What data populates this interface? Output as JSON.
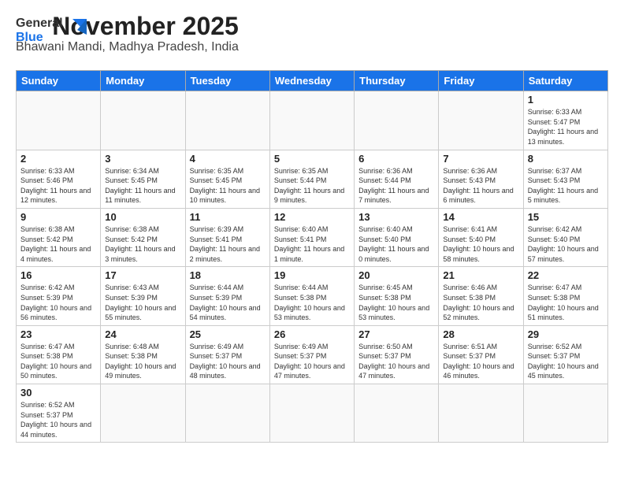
{
  "logo": {
    "general": "General",
    "blue": "Blue"
  },
  "header": {
    "month": "November 2025",
    "location": "Bhawani Mandi, Madhya Pradesh, India"
  },
  "weekdays": [
    "Sunday",
    "Monday",
    "Tuesday",
    "Wednesday",
    "Thursday",
    "Friday",
    "Saturday"
  ],
  "days": {
    "d1": {
      "n": "1",
      "sr": "6:33 AM",
      "ss": "5:47 PM",
      "dl": "11 hours and 13 minutes."
    },
    "d2": {
      "n": "2",
      "sr": "6:33 AM",
      "ss": "5:46 PM",
      "dl": "11 hours and 12 minutes."
    },
    "d3": {
      "n": "3",
      "sr": "6:34 AM",
      "ss": "5:45 PM",
      "dl": "11 hours and 11 minutes."
    },
    "d4": {
      "n": "4",
      "sr": "6:35 AM",
      "ss": "5:45 PM",
      "dl": "11 hours and 10 minutes."
    },
    "d5": {
      "n": "5",
      "sr": "6:35 AM",
      "ss": "5:44 PM",
      "dl": "11 hours and 9 minutes."
    },
    "d6": {
      "n": "6",
      "sr": "6:36 AM",
      "ss": "5:44 PM",
      "dl": "11 hours and 7 minutes."
    },
    "d7": {
      "n": "7",
      "sr": "6:36 AM",
      "ss": "5:43 PM",
      "dl": "11 hours and 6 minutes."
    },
    "d8": {
      "n": "8",
      "sr": "6:37 AM",
      "ss": "5:43 PM",
      "dl": "11 hours and 5 minutes."
    },
    "d9": {
      "n": "9",
      "sr": "6:38 AM",
      "ss": "5:42 PM",
      "dl": "11 hours and 4 minutes."
    },
    "d10": {
      "n": "10",
      "sr": "6:38 AM",
      "ss": "5:42 PM",
      "dl": "11 hours and 3 minutes."
    },
    "d11": {
      "n": "11",
      "sr": "6:39 AM",
      "ss": "5:41 PM",
      "dl": "11 hours and 2 minutes."
    },
    "d12": {
      "n": "12",
      "sr": "6:40 AM",
      "ss": "5:41 PM",
      "dl": "11 hours and 1 minute."
    },
    "d13": {
      "n": "13",
      "sr": "6:40 AM",
      "ss": "5:40 PM",
      "dl": "11 hours and 0 minutes."
    },
    "d14": {
      "n": "14",
      "sr": "6:41 AM",
      "ss": "5:40 PM",
      "dl": "10 hours and 58 minutes."
    },
    "d15": {
      "n": "15",
      "sr": "6:42 AM",
      "ss": "5:40 PM",
      "dl": "10 hours and 57 minutes."
    },
    "d16": {
      "n": "16",
      "sr": "6:42 AM",
      "ss": "5:39 PM",
      "dl": "10 hours and 56 minutes."
    },
    "d17": {
      "n": "17",
      "sr": "6:43 AM",
      "ss": "5:39 PM",
      "dl": "10 hours and 55 minutes."
    },
    "d18": {
      "n": "18",
      "sr": "6:44 AM",
      "ss": "5:39 PM",
      "dl": "10 hours and 54 minutes."
    },
    "d19": {
      "n": "19",
      "sr": "6:44 AM",
      "ss": "5:38 PM",
      "dl": "10 hours and 53 minutes."
    },
    "d20": {
      "n": "20",
      "sr": "6:45 AM",
      "ss": "5:38 PM",
      "dl": "10 hours and 53 minutes."
    },
    "d21": {
      "n": "21",
      "sr": "6:46 AM",
      "ss": "5:38 PM",
      "dl": "10 hours and 52 minutes."
    },
    "d22": {
      "n": "22",
      "sr": "6:47 AM",
      "ss": "5:38 PM",
      "dl": "10 hours and 51 minutes."
    },
    "d23": {
      "n": "23",
      "sr": "6:47 AM",
      "ss": "5:38 PM",
      "dl": "10 hours and 50 minutes."
    },
    "d24": {
      "n": "24",
      "sr": "6:48 AM",
      "ss": "5:38 PM",
      "dl": "10 hours and 49 minutes."
    },
    "d25": {
      "n": "25",
      "sr": "6:49 AM",
      "ss": "5:37 PM",
      "dl": "10 hours and 48 minutes."
    },
    "d26": {
      "n": "26",
      "sr": "6:49 AM",
      "ss": "5:37 PM",
      "dl": "10 hours and 47 minutes."
    },
    "d27": {
      "n": "27",
      "sr": "6:50 AM",
      "ss": "5:37 PM",
      "dl": "10 hours and 47 minutes."
    },
    "d28": {
      "n": "28",
      "sr": "6:51 AM",
      "ss": "5:37 PM",
      "dl": "10 hours and 46 minutes."
    },
    "d29": {
      "n": "29",
      "sr": "6:52 AM",
      "ss": "5:37 PM",
      "dl": "10 hours and 45 minutes."
    },
    "d30": {
      "n": "30",
      "sr": "6:52 AM",
      "ss": "5:37 PM",
      "dl": "10 hours and 44 minutes."
    }
  }
}
